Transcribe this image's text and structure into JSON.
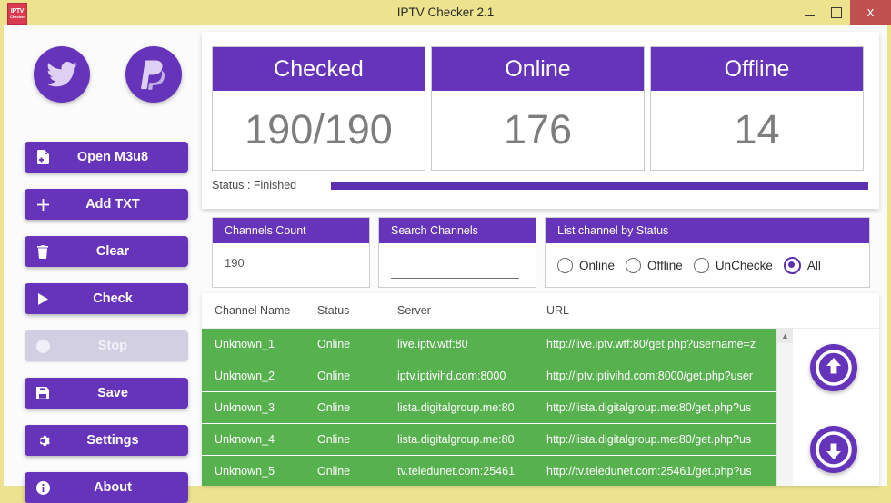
{
  "window": {
    "title": "IPTV Checker 2.1",
    "icon_line1": "IPTV",
    "icon_line2": "Checker",
    "minimize_label": "Minimize",
    "maximize_label": "Maximize",
    "close_label": "x",
    "titlebar_color": "#ede28e",
    "close_color": "#c0504d"
  },
  "theme": {
    "accent": "#6633bb",
    "progress": "#5b2fb0",
    "row_green": "#57b14e",
    "disabled": "#d3cfe3"
  },
  "sidebar": {
    "social": [
      {
        "name": "twitter-icon",
        "label": "Twitter"
      },
      {
        "name": "paypal-icon",
        "label": "PayPal"
      }
    ],
    "buttons": [
      {
        "label": "Open M3u8",
        "icon": "file-add-icon",
        "disabled": false
      },
      {
        "label": "Add TXT",
        "icon": "plus-icon",
        "disabled": false
      },
      {
        "label": "Clear",
        "icon": "trash-icon",
        "disabled": false
      },
      {
        "label": "Check",
        "icon": "play-icon",
        "disabled": false
      },
      {
        "label": "Stop",
        "icon": "stop-circle-icon",
        "disabled": true
      },
      {
        "label": "Save",
        "icon": "floppy-icon",
        "disabled": false
      },
      {
        "label": "Settings",
        "icon": "gear-icon",
        "disabled": false
      },
      {
        "label": "About",
        "icon": "info-icon",
        "disabled": false
      }
    ]
  },
  "stats": [
    {
      "title": "Checked",
      "value": "190/190"
    },
    {
      "title": "Online",
      "value": "176"
    },
    {
      "title": "Offline",
      "value": "14"
    }
  ],
  "status": {
    "label": "Status : Finished",
    "progress_percent": 100
  },
  "filters": {
    "channels_count": {
      "title": "Channels Count",
      "value": "190"
    },
    "search": {
      "title": "Search Channels",
      "value": "",
      "placeholder": ""
    },
    "list_by_status": {
      "title": "List channel by Status",
      "options": [
        {
          "label": "Online",
          "selected": false
        },
        {
          "label": "Offline",
          "selected": false
        },
        {
          "label": "UnChecked",
          "selected": false
        },
        {
          "label": "All",
          "selected": true
        }
      ]
    }
  },
  "table": {
    "columns": [
      "Channel Name",
      "Status",
      "Server",
      "URL"
    ],
    "rows": [
      {
        "name": "Unknown_1",
        "status": "Online",
        "server": "live.iptv.wtf:80",
        "url": "http://live.iptv.wtf:80/get.php?username=z"
      },
      {
        "name": "Unknown_2",
        "status": "Online",
        "server": "iptv.iptivihd.com:8000",
        "url": "http://iptv.iptivihd.com:8000/get.php?user"
      },
      {
        "name": "Unknown_3",
        "status": "Online",
        "server": "lista.digitalgroup.me:80",
        "url": "http://lista.digitalgroup.me:80/get.php?us"
      },
      {
        "name": "Unknown_4",
        "status": "Online",
        "server": "lista.digitalgroup.me:80",
        "url": "http://lista.digitalgroup.me:80/get.php?us"
      },
      {
        "name": "Unknown_5",
        "status": "Online",
        "server": "tv.teledunet.com:25461",
        "url": "http://tv.teledunet.com:25461/get.php?us"
      }
    ]
  },
  "nav": {
    "scroll_up_label": "Scroll up",
    "move_up_label": "Move up",
    "move_down_label": "Move down"
  }
}
